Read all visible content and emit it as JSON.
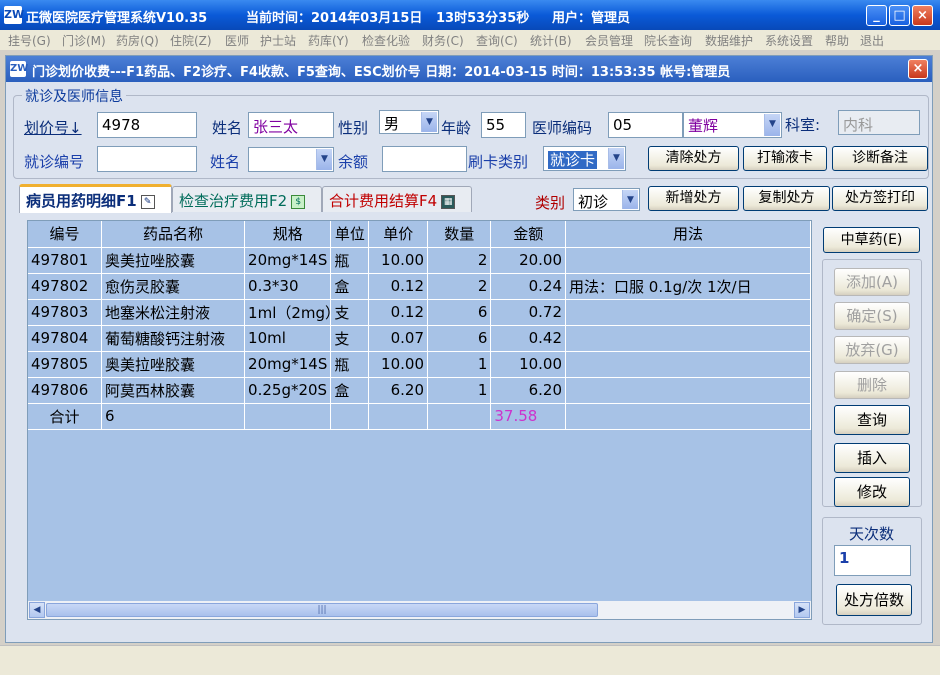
{
  "window": {
    "title": "正微医院医疗管理系统V10.35",
    "time_label": "当前时间：2014年03月15日",
    "clock": "13时53分35秒",
    "user_label": "用户：管理员",
    "app_icon": "zw-logo-icon",
    "min": "_",
    "max": "□",
    "close": "×"
  },
  "menu": [
    "挂号(G)",
    "门诊(M)",
    "药房(Q)",
    "住院(Z)",
    "医师",
    "护士站",
    "药库(Y)",
    "检查化验",
    "财务(C)",
    "查询(C)",
    "统计(B)",
    "会员管理",
    "院长查询",
    "数据维护",
    "系统设置",
    "帮助",
    "退出"
  ],
  "child": {
    "title": "门诊划价收费---F1药品、F2诊疗、F4收款、F5查询、ESC划价号  日期：2014-03-15 时间：13:53:35  帐号:管理员",
    "close": "×"
  },
  "group": {
    "legend": "就诊及医师信息",
    "price_no_label": "划价号↓",
    "price_no": "4978",
    "name_label": "姓名",
    "name": "张三太",
    "gender_label": "性别",
    "gender": "男",
    "age_label": "年龄",
    "age": "55",
    "doctor_code_label": "医师编码",
    "doctor_code": "05",
    "doctor_name": "董辉",
    "dept_label": "科室:",
    "dept": "内科",
    "visit_no_label": "就诊编号",
    "visit_no": "",
    "name2_label": "姓名",
    "name2": "",
    "balance_label": "余额",
    "balance": "",
    "card_type_label": "刷卡类别",
    "card_type": "就诊卡",
    "btn_clear": "清除处方",
    "btn_print_infusion": "打输液卡",
    "btn_diag_note": "诊断备注"
  },
  "tabs": [
    {
      "label": "病员用药明细F1",
      "icon": "edit-doc-icon"
    },
    {
      "label": "检查治疗费用F2",
      "icon": "money-bag-icon"
    },
    {
      "label": "合计费用结算F4",
      "icon": "calculator-icon"
    }
  ],
  "category": {
    "label": "类别",
    "value": "初诊",
    "btn_new": "新增处方",
    "btn_copy": "复制处方",
    "btn_sign_print": "处方签打印"
  },
  "table": {
    "columns": [
      "编号",
      "药品名称",
      "规格",
      "单位",
      "单价",
      "数量",
      "金额",
      "用法"
    ],
    "rows": [
      [
        "497801",
        "奥美拉唑胶囊",
        "20mg*14S",
        "瓶",
        "10.00",
        "2",
        "20.00",
        ""
      ],
      [
        "497802",
        "愈伤灵胶囊",
        "0.3*30",
        "盒",
        "0.12",
        "2",
        "0.24",
        "用法：口服 0.1g/次 1次/日"
      ],
      [
        "497803",
        "地塞米松注射液",
        "1ml（2mg）",
        "支",
        "0.12",
        "6",
        "0.72",
        ""
      ],
      [
        "497804",
        "葡萄糖酸钙注射液",
        "10ml",
        "支",
        "0.07",
        "6",
        "0.42",
        ""
      ],
      [
        "497805",
        "奥美拉唑胶囊",
        "20mg*14S",
        "瓶",
        "10.00",
        "1",
        "10.00",
        ""
      ],
      [
        "497806",
        "阿莫西林胶囊",
        "0.25g*20S",
        "盒",
        "6.20",
        "1",
        "6.20",
        ""
      ]
    ],
    "total_label": "合计",
    "total_count": "6",
    "total_amount": "37.58"
  },
  "side": {
    "btn_herbal": "中草药(E)",
    "btn_add": "添加(A)",
    "btn_confirm": "确定(S)",
    "btn_abandon": "放弃(G)",
    "btn_delete": "删除",
    "btn_query": "查询",
    "btn_insert": "插入",
    "btn_modify": "修改",
    "days_label": "天次数",
    "days_value": "1",
    "btn_multiple": "处方倍数"
  }
}
